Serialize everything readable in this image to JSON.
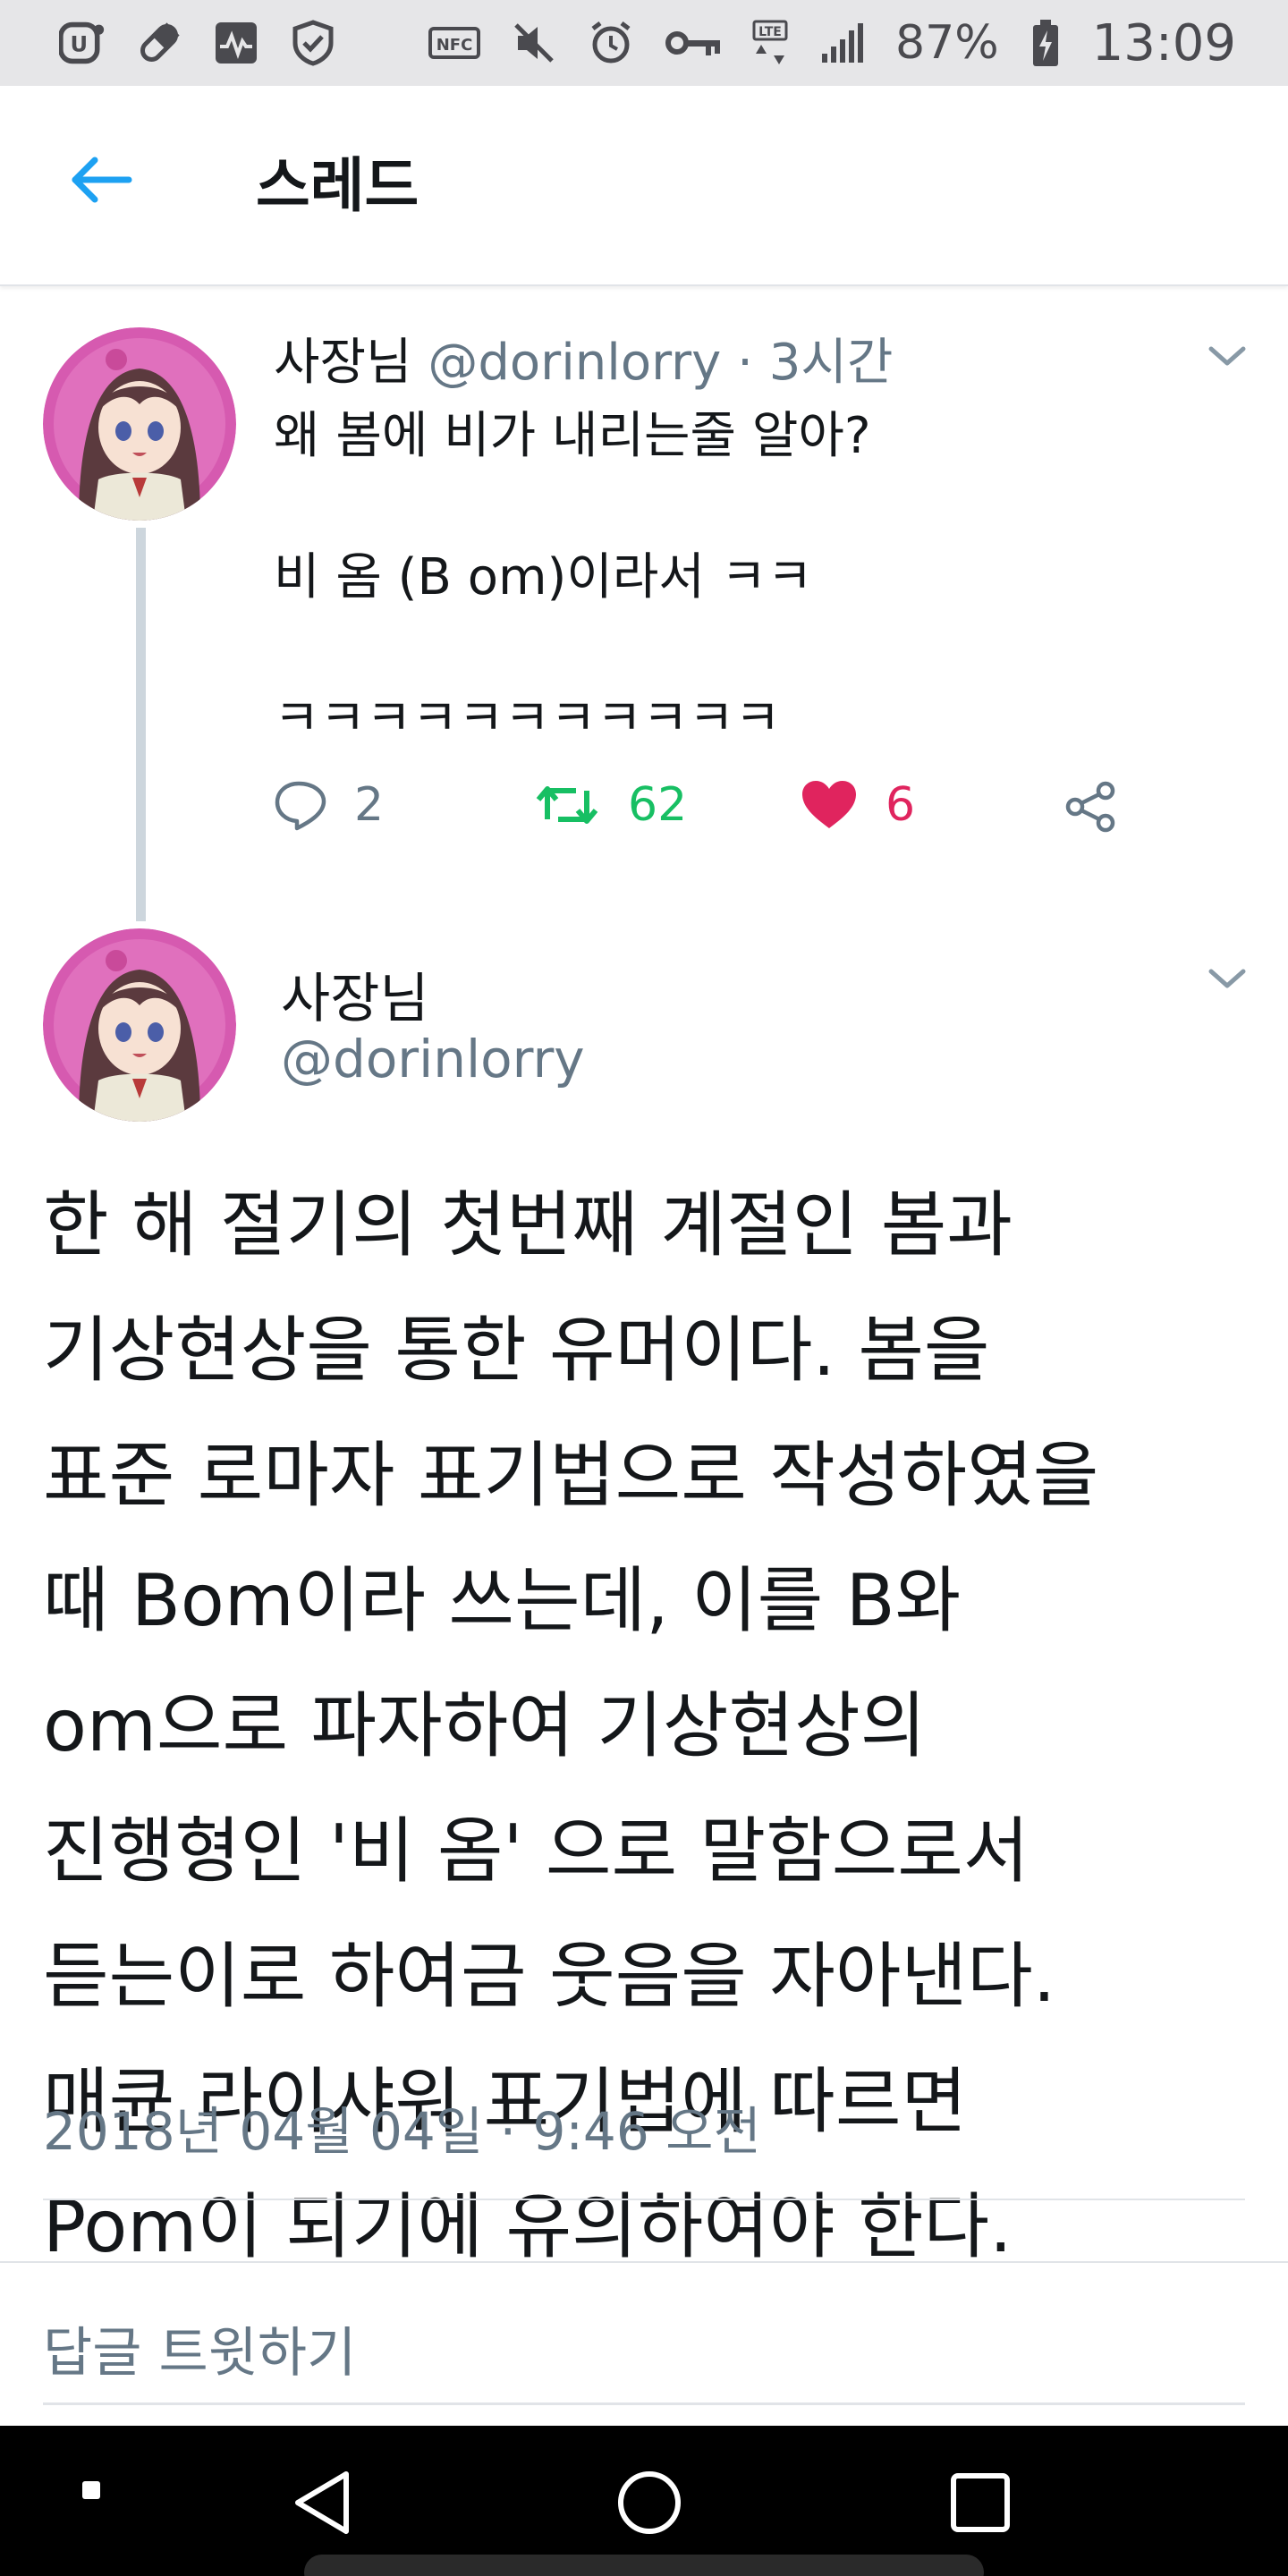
{
  "status_bar": {
    "left_icons": [
      "u-plus-icon",
      "pill-icon",
      "activity-icon",
      "shield-icon"
    ],
    "nfc_label": "NFC",
    "lte_label": "LTE",
    "battery_percent": "87%",
    "time": "13:09"
  },
  "header": {
    "back_icon": "arrow-left-icon",
    "title": "스레드"
  },
  "tweet_1": {
    "name": "사장님",
    "handle": "@dorinlorry",
    "separator": "·",
    "time_ago": "3시간",
    "lines": [
      "왜 봄에 비가 내리는줄 알아?",
      "비 옴 (B om)이라서 ㅋㅋ",
      "ㅋㅋㅋㅋㅋㅋㅋㅋㅋㅋㅋ"
    ],
    "actions": {
      "reply_count": "2",
      "retweet_count": "62",
      "like_count": "6"
    }
  },
  "tweet_2": {
    "name": "사장님",
    "handle": "@dorinlorry",
    "body_lines": [
      "한 해 절기의 첫번째 계절인 봄과",
      "기상현상을 통한 유머이다. 봄을",
      "표준 로마자 표기법으로 작성하였을",
      "때 Bom이라 쓰는데, 이를 B와",
      "om으로 파자하여 기상현상의",
      "진행형인 '비 옴' 으로 말함으로서",
      "듣는이로 하여금 웃음을 자아낸다.",
      "매큔 라이샤워 표기법에 따르면",
      "Pom이 되기에 유의하여야 한다."
    ],
    "timestamp": "2018년 04월 04일 · 9:46 오전"
  },
  "reply_bar": {
    "placeholder": "답글 트윗하기"
  },
  "nav_bar": {
    "icons": [
      "recent-dot-icon",
      "back-triangle-icon",
      "home-circle-icon",
      "overview-square-icon"
    ]
  },
  "colors": {
    "accent": "#1da1f2",
    "retweet": "#17bf63",
    "like": "#e0245e",
    "secondary_text": "#657786"
  }
}
